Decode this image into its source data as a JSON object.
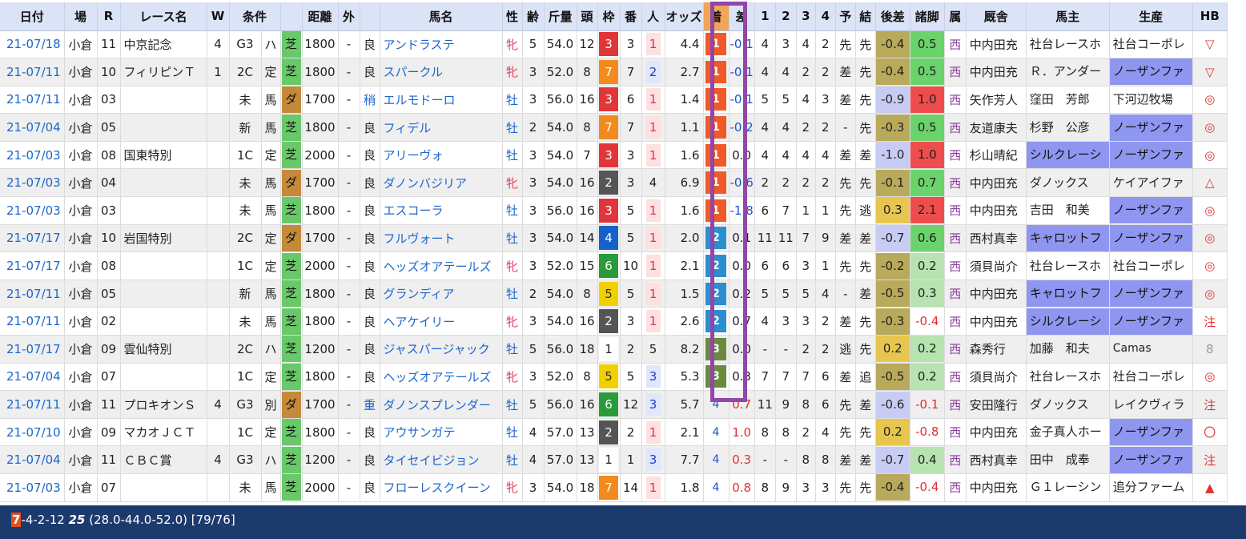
{
  "headers": [
    "日付",
    "場",
    "R",
    "レース名",
    "W",
    "条件",
    "",
    "距離",
    "外",
    "",
    "馬名",
    "性",
    "齢",
    "斤量",
    "頭",
    "枠",
    "番",
    "人",
    "オッズ",
    "着",
    "差",
    "1",
    "2",
    "3",
    "4",
    "予",
    "結",
    "後差",
    "諸脚",
    "属",
    "厩舎",
    "馬主",
    "生産",
    "HB"
  ],
  "rows": [
    {
      "date": "21-07/18",
      "place": "小倉",
      "r": "11",
      "race": "中京記念",
      "w": "4",
      "grade": "G3",
      "cond": "ハ",
      "surface": "芝",
      "dist": "1800",
      "out": "-",
      "track": "良",
      "horse": "アンドラステ",
      "sex": "牝",
      "age": "5",
      "weight": "54.0",
      "heads": "12",
      "waku": "3",
      "num": "3",
      "ninki": "1",
      "odds": "4.4",
      "finish": "1",
      "diff": "-0.1",
      "c1": "4",
      "c2": "3",
      "c3": "4",
      "c4": "2",
      "yo": "先",
      "ketsu": "先",
      "gosa": "-0.4",
      "shokyaku": "0.5",
      "belong": "西",
      "stable": "中内田充",
      "owner": "社台レースホ",
      "breeder": "社台コーポレ",
      "hb": "▽"
    },
    {
      "date": "21-07/11",
      "place": "小倉",
      "r": "10",
      "race": "フィリピンＴ",
      "w": "1",
      "grade": "2C",
      "cond": "定",
      "surface": "芝",
      "dist": "1800",
      "out": "-",
      "track": "良",
      "horse": "スパークル",
      "sex": "牝",
      "age": "3",
      "weight": "52.0",
      "heads": "8",
      "waku": "7",
      "num": "7",
      "ninki": "2",
      "odds": "2.7",
      "finish": "1",
      "diff": "-0.1",
      "c1": "4",
      "c2": "4",
      "c3": "2",
      "c4": "2",
      "yo": "差",
      "ketsu": "先",
      "gosa": "-0.4",
      "shokyaku": "0.5",
      "belong": "西",
      "stable": "中内田充",
      "owner": "Ｒ．アンダー",
      "breeder": "ノーザンファ",
      "hb": "▽"
    },
    {
      "date": "21-07/11",
      "place": "小倉",
      "r": "03",
      "race": "",
      "w": "",
      "grade": "未",
      "cond": "馬",
      "surface": "ダ",
      "dist": "1700",
      "out": "-",
      "track": "稍",
      "horse": "エルモドーロ",
      "sex": "牡",
      "age": "3",
      "weight": "56.0",
      "heads": "16",
      "waku": "3",
      "num": "6",
      "ninki": "1",
      "odds": "1.4",
      "finish": "1",
      "diff": "-0.1",
      "c1": "5",
      "c2": "5",
      "c3": "4",
      "c4": "3",
      "yo": "差",
      "ketsu": "先",
      "gosa": "-0.9",
      "shokyaku": "1.0",
      "belong": "西",
      "stable": "矢作芳人",
      "owner": "窪田　芳郎",
      "breeder": "下河辺牧場",
      "hb": "◎"
    },
    {
      "date": "21-07/04",
      "place": "小倉",
      "r": "05",
      "race": "",
      "w": "",
      "grade": "新",
      "cond": "馬",
      "surface": "芝",
      "dist": "1800",
      "out": "-",
      "track": "良",
      "horse": "フィデル",
      "sex": "牡",
      "age": "2",
      "weight": "54.0",
      "heads": "8",
      "waku": "7",
      "num": "7",
      "ninki": "1",
      "odds": "1.1",
      "finish": "1",
      "diff": "-0.2",
      "c1": "4",
      "c2": "4",
      "c3": "2",
      "c4": "2",
      "yo": "-",
      "ketsu": "先",
      "gosa": "-0.3",
      "shokyaku": "0.5",
      "belong": "西",
      "stable": "友道康夫",
      "owner": "杉野　公彦",
      "breeder": "ノーザンファ",
      "hb": "◎"
    },
    {
      "date": "21-07/03",
      "place": "小倉",
      "r": "08",
      "race": "国東特別",
      "w": "",
      "grade": "1C",
      "cond": "定",
      "surface": "芝",
      "dist": "2000",
      "out": "-",
      "track": "良",
      "horse": "アリーヴォ",
      "sex": "牡",
      "age": "3",
      "weight": "54.0",
      "heads": "7",
      "waku": "3",
      "num": "3",
      "ninki": "1",
      "odds": "1.6",
      "finish": "1",
      "diff": "0.0",
      "c1": "4",
      "c2": "4",
      "c3": "4",
      "c4": "4",
      "yo": "差",
      "ketsu": "差",
      "gosa": "-1.0",
      "shokyaku": "1.0",
      "belong": "西",
      "stable": "杉山晴紀",
      "owner": "シルクレーシ",
      "breeder": "ノーザンファ",
      "hb": "◎"
    },
    {
      "date": "21-07/03",
      "place": "小倉",
      "r": "04",
      "race": "",
      "w": "",
      "grade": "未",
      "cond": "馬",
      "surface": "ダ",
      "dist": "1700",
      "out": "-",
      "track": "良",
      "horse": "ダノンバジリア",
      "sex": "牝",
      "age": "3",
      "weight": "54.0",
      "heads": "16",
      "waku": "2",
      "num": "3",
      "ninki": "4",
      "odds": "6.9",
      "finish": "1",
      "diff": "-0.6",
      "c1": "2",
      "c2": "2",
      "c3": "2",
      "c4": "2",
      "yo": "先",
      "ketsu": "先",
      "gosa": "-0.1",
      "shokyaku": "0.7",
      "belong": "西",
      "stable": "中内田充",
      "owner": "ダノックス",
      "breeder": "ケイアイファ",
      "hb": "△"
    },
    {
      "date": "21-07/03",
      "place": "小倉",
      "r": "03",
      "race": "",
      "w": "",
      "grade": "未",
      "cond": "馬",
      "surface": "芝",
      "dist": "1800",
      "out": "-",
      "track": "良",
      "horse": "エスコーラ",
      "sex": "牡",
      "age": "3",
      "weight": "56.0",
      "heads": "16",
      "waku": "3",
      "num": "5",
      "ninki": "1",
      "odds": "1.6",
      "finish": "1",
      "diff": "-1.8",
      "c1": "6",
      "c2": "7",
      "c3": "1",
      "c4": "1",
      "yo": "先",
      "ketsu": "逃",
      "gosa": "0.3",
      "shokyaku": "2.1",
      "belong": "西",
      "stable": "中内田充",
      "owner": "吉田　和美",
      "breeder": "ノーザンファ",
      "hb": "◎"
    },
    {
      "date": "21-07/17",
      "place": "小倉",
      "r": "10",
      "race": "岩国特別",
      "w": "",
      "grade": "2C",
      "cond": "定",
      "surface": "ダ",
      "dist": "1700",
      "out": "-",
      "track": "良",
      "horse": "フルヴォート",
      "sex": "牡",
      "age": "3",
      "weight": "54.0",
      "heads": "14",
      "waku": "4",
      "num": "5",
      "ninki": "1",
      "odds": "2.0",
      "finish": "2",
      "diff": "0.1",
      "c1": "11",
      "c2": "11",
      "c3": "7",
      "c4": "9",
      "yo": "差",
      "ketsu": "差",
      "gosa": "-0.7",
      "shokyaku": "0.6",
      "belong": "西",
      "stable": "西村真幸",
      "owner": "キャロットフ",
      "breeder": "ノーザンファ",
      "hb": "◎"
    },
    {
      "date": "21-07/17",
      "place": "小倉",
      "r": "08",
      "race": "",
      "w": "",
      "grade": "1C",
      "cond": "定",
      "surface": "芝",
      "dist": "2000",
      "out": "-",
      "track": "良",
      "horse": "ヘッズオアテールズ",
      "sex": "牝",
      "age": "3",
      "weight": "52.0",
      "heads": "15",
      "waku": "6",
      "num": "10",
      "ninki": "1",
      "odds": "2.1",
      "finish": "2",
      "diff": "0.0",
      "c1": "6",
      "c2": "6",
      "c3": "3",
      "c4": "1",
      "yo": "先",
      "ketsu": "先",
      "gosa": "-0.2",
      "shokyaku": "0.2",
      "belong": "西",
      "stable": "須貝尚介",
      "owner": "社台レースホ",
      "breeder": "社台コーポレ",
      "hb": "◎"
    },
    {
      "date": "21-07/11",
      "place": "小倉",
      "r": "05",
      "race": "",
      "w": "",
      "grade": "新",
      "cond": "馬",
      "surface": "芝",
      "dist": "1800",
      "out": "-",
      "track": "良",
      "horse": "グランディア",
      "sex": "牡",
      "age": "2",
      "weight": "54.0",
      "heads": "8",
      "waku": "5",
      "num": "5",
      "ninki": "1",
      "odds": "1.5",
      "finish": "2",
      "diff": "0.2",
      "c1": "5",
      "c2": "5",
      "c3": "5",
      "c4": "4",
      "yo": "-",
      "ketsu": "差",
      "gosa": "-0.5",
      "shokyaku": "0.3",
      "belong": "西",
      "stable": "中内田充",
      "owner": "キャロットフ",
      "breeder": "ノーザンファ",
      "hb": "◎"
    },
    {
      "date": "21-07/11",
      "place": "小倉",
      "r": "02",
      "race": "",
      "w": "",
      "grade": "未",
      "cond": "馬",
      "surface": "芝",
      "dist": "1800",
      "out": "-",
      "track": "良",
      "horse": "ヘアケイリー",
      "sex": "牝",
      "age": "3",
      "weight": "54.0",
      "heads": "16",
      "waku": "2",
      "num": "3",
      "ninki": "1",
      "odds": "2.6",
      "finish": "2",
      "diff": "0.7",
      "c1": "4",
      "c2": "3",
      "c3": "3",
      "c4": "2",
      "yo": "差",
      "ketsu": "先",
      "gosa": "-0.3",
      "shokyaku": "-0.4",
      "belong": "西",
      "stable": "中内田充",
      "owner": "シルクレーシ",
      "breeder": "ノーザンファ",
      "hb": "注"
    },
    {
      "date": "21-07/17",
      "place": "小倉",
      "r": "09",
      "race": "雲仙特別",
      "w": "",
      "grade": "2C",
      "cond": "ハ",
      "surface": "芝",
      "dist": "1200",
      "out": "-",
      "track": "良",
      "horse": "ジャスパージャック",
      "sex": "牡",
      "age": "5",
      "weight": "56.0",
      "heads": "18",
      "waku": "1",
      "num": "2",
      "ninki": "5",
      "odds": "8.2",
      "finish": "3",
      "diff": "0.0",
      "c1": "-",
      "c2": "-",
      "c3": "2",
      "c4": "2",
      "yo": "逃",
      "ketsu": "先",
      "gosa": "0.2",
      "shokyaku": "0.2",
      "belong": "西",
      "stable": "森秀行",
      "owner": "加藤　和夫",
      "breeder": "Camas",
      "hb": "8"
    },
    {
      "date": "21-07/04",
      "place": "小倉",
      "r": "07",
      "race": "",
      "w": "",
      "grade": "1C",
      "cond": "定",
      "surface": "芝",
      "dist": "1800",
      "out": "-",
      "track": "良",
      "horse": "ヘッズオアテールズ",
      "sex": "牝",
      "age": "3",
      "weight": "52.0",
      "heads": "8",
      "waku": "5",
      "num": "5",
      "ninki": "3",
      "odds": "5.3",
      "finish": "3",
      "diff": "0.3",
      "c1": "7",
      "c2": "7",
      "c3": "7",
      "c4": "6",
      "yo": "差",
      "ketsu": "追",
      "gosa": "-0.5",
      "shokyaku": "0.2",
      "belong": "西",
      "stable": "須貝尚介",
      "owner": "社台レースホ",
      "breeder": "社台コーポレ",
      "hb": "◎"
    },
    {
      "date": "21-07/11",
      "place": "小倉",
      "r": "11",
      "race": "プロキオンＳ",
      "w": "4",
      "grade": "G3",
      "cond": "別",
      "surface": "ダ",
      "dist": "1700",
      "out": "-",
      "track": "重",
      "horse": "ダノンスプレンダー",
      "sex": "牡",
      "age": "5",
      "weight": "56.0",
      "heads": "16",
      "waku": "6",
      "num": "12",
      "ninki": "3",
      "odds": "5.7",
      "finish": "4",
      "diff": "0.7",
      "c1": "11",
      "c2": "9",
      "c3": "8",
      "c4": "6",
      "yo": "先",
      "ketsu": "差",
      "gosa": "-0.6",
      "shokyaku": "-0.1",
      "belong": "西",
      "stable": "安田隆行",
      "owner": "ダノックス",
      "breeder": "レイクヴィラ",
      "hb": "注"
    },
    {
      "date": "21-07/10",
      "place": "小倉",
      "r": "09",
      "race": "マカオＪＣＴ",
      "w": "",
      "grade": "1C",
      "cond": "定",
      "surface": "芝",
      "dist": "1800",
      "out": "-",
      "track": "良",
      "horse": "アウサンガテ",
      "sex": "牡",
      "age": "4",
      "weight": "57.0",
      "heads": "13",
      "waku": "2",
      "num": "2",
      "ninki": "1",
      "odds": "2.1",
      "finish": "4",
      "diff": "1.0",
      "c1": "8",
      "c2": "8",
      "c3": "2",
      "c4": "4",
      "yo": "先",
      "ketsu": "先",
      "gosa": "0.2",
      "shokyaku": "-0.8",
      "belong": "西",
      "stable": "中内田充",
      "owner": "金子真人ホー",
      "breeder": "ノーザンファ",
      "hb": "〇"
    },
    {
      "date": "21-07/04",
      "place": "小倉",
      "r": "11",
      "race": "ＣＢＣ賞",
      "w": "4",
      "grade": "G3",
      "cond": "ハ",
      "surface": "芝",
      "dist": "1200",
      "out": "-",
      "track": "良",
      "horse": "タイセイビジョン",
      "sex": "牡",
      "age": "4",
      "weight": "57.0",
      "heads": "13",
      "waku": "1",
      "num": "1",
      "ninki": "3",
      "odds": "7.7",
      "finish": "4",
      "diff": "0.3",
      "c1": "-",
      "c2": "-",
      "c3": "8",
      "c4": "8",
      "yo": "差",
      "ketsu": "差",
      "gosa": "-0.7",
      "shokyaku": "0.4",
      "belong": "西",
      "stable": "西村真幸",
      "owner": "田中　成奉",
      "breeder": "ノーザンファ",
      "hb": "注"
    },
    {
      "date": "21-07/03",
      "place": "小倉",
      "r": "07",
      "race": "",
      "w": "",
      "grade": "未",
      "cond": "馬",
      "surface": "芝",
      "dist": "2000",
      "out": "-",
      "track": "良",
      "horse": "フローレスクイーン",
      "sex": "牝",
      "age": "3",
      "weight": "54.0",
      "heads": "18",
      "waku": "7",
      "num": "14",
      "ninki": "1",
      "odds": "1.8",
      "finish": "4",
      "diff": "0.8",
      "c1": "8",
      "c2": "9",
      "c3": "3",
      "c4": "3",
      "yo": "先",
      "ketsu": "先",
      "gosa": "-0.4",
      "shokyaku": "-0.4",
      "belong": "西",
      "stable": "中内田充",
      "owner": "Ｇ１レーシン",
      "breeder": "追分ファーム",
      "hb": "▲"
    }
  ],
  "footer": {
    "first": "7",
    "rest": "-4-2-12 ",
    "bold": "25",
    "tail": " (28.0-44.0-52.0) [79/76]"
  },
  "colors": {
    "highlight": "#9246a8",
    "footer_bg": "#1c3a6c",
    "header_bg": "#dbe4f6"
  }
}
